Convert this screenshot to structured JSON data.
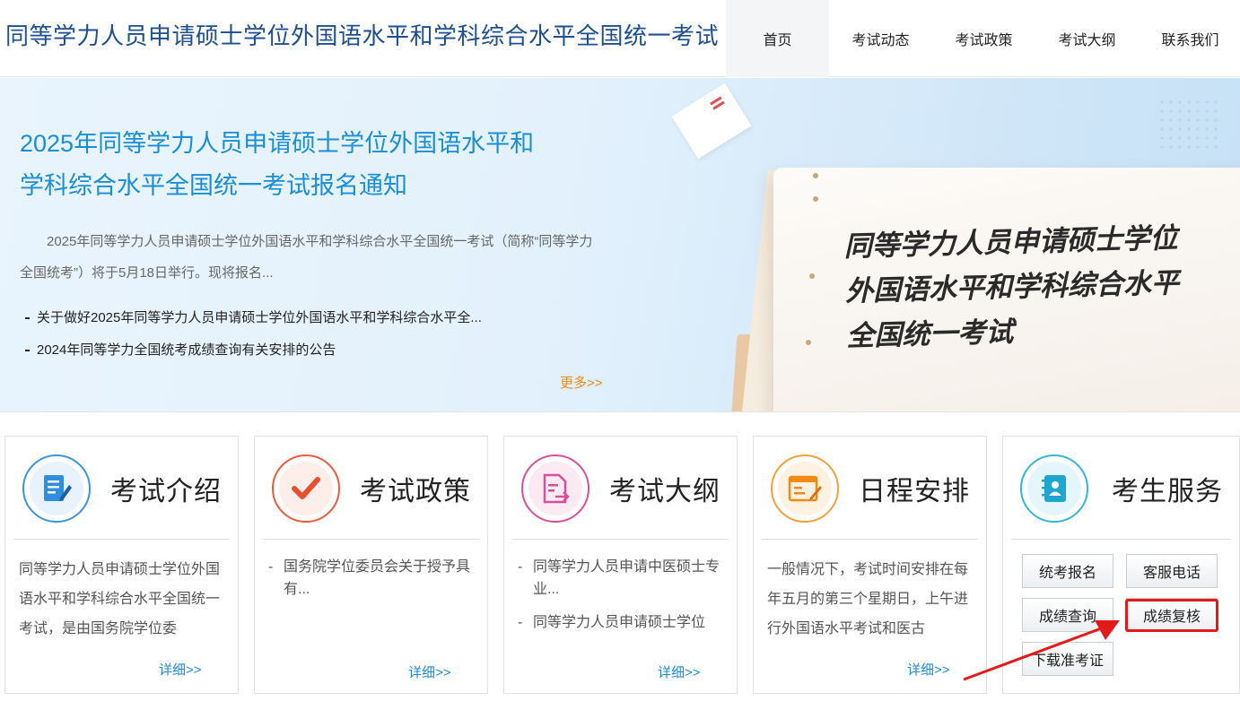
{
  "header": {
    "site_title": "同等学力人员申请硕士学位外国语水平和学科综合水平全国统一考试",
    "nav": [
      "首页",
      "考试动态",
      "考试政策",
      "考试大纲",
      "联系我们"
    ]
  },
  "banner": {
    "title_line1": "2025年同等学力人员申请硕士学位外国语水平和",
    "title_line2": "学科综合水平全国统一考试报名通知",
    "summary": "2025年同等学力人员申请硕士学位外国语水平和学科综合水平全国统一考试（简称“同等学力全国统考”）将于5月18日举行。现将报名...",
    "news": [
      "关于做好2025年同等学力人员申请硕士学位外国语水平和学科综合水平全...",
      "2024年同等学力全国统考成绩查询有关安排的公告"
    ],
    "more": "更多>>",
    "board_line1": "同等学力人员申请硕士学位",
    "board_line2": "外国语水平和学科综合水平",
    "board_line3": "全国统一考试"
  },
  "cards": {
    "intro": {
      "title": "考试介绍",
      "text": "同等学力人员申请硕士学位外国语水平和学科综合水平全国统一考试，是由国务院学位委",
      "more": "详细>>"
    },
    "policy": {
      "title": "考试政策",
      "items": [
        "国务院学位委员会关于授予具有..."
      ],
      "more": "详细>>"
    },
    "outline": {
      "title": "考试大纲",
      "items": [
        "同等学力人员申请中医硕士专业...",
        "同等学力人员申请硕士学位"
      ],
      "more": "详细>>"
    },
    "schedule": {
      "title": "日程安排",
      "text": "一般情况下，考试时间安排在每年五月的第三个星期日，上午进行外国语水平考试和医古",
      "more": "详细>>"
    },
    "service": {
      "title": "考生服务",
      "buttons": [
        "统考报名",
        "客服电话",
        "成绩查询",
        "成绩复核",
        "下载准考证"
      ]
    }
  },
  "colors": {
    "brand_blue": "#1d4f91",
    "link_blue": "#1b8bd6",
    "more_orange": "#f08a12",
    "highlight_red": "#e31a1a"
  }
}
